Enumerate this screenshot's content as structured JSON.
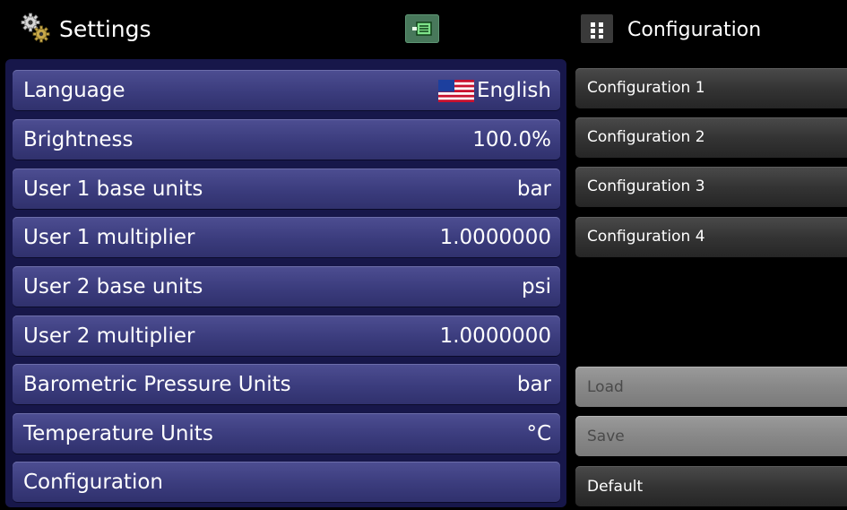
{
  "header": {
    "title": "Settings",
    "title_icon": "gears-icon",
    "io_icon": "io-module-icon",
    "config_title": "Configuration",
    "config_icon": "grid-menu-icon"
  },
  "settings": {
    "rows": [
      {
        "label": "Language",
        "value": "English",
        "icon": "us-flag-icon"
      },
      {
        "label": "Brightness",
        "value": "100.0%"
      },
      {
        "label": "User 1 base units",
        "value": "bar"
      },
      {
        "label": "User 1 multiplier",
        "value": "1.0000000"
      },
      {
        "label": "User 2 base units",
        "value": "psi"
      },
      {
        "label": "User 2 multiplier",
        "value": "1.0000000"
      },
      {
        "label": "Barometric Pressure Units",
        "value": "bar"
      },
      {
        "label": "Temperature Units",
        "value": "°C"
      },
      {
        "label": "Configuration",
        "value": ""
      }
    ]
  },
  "configuration": {
    "items": [
      "Configuration 1",
      "Configuration 2",
      "Configuration 3",
      "Configuration 4"
    ],
    "actions": {
      "load": {
        "label": "Load",
        "enabled": false
      },
      "save": {
        "label": "Save",
        "enabled": false
      },
      "default": {
        "label": "Default",
        "enabled": true
      }
    }
  },
  "colors": {
    "panel": "#17174a",
    "row": "#3b3c7d",
    "io_button": "#48785b",
    "config_item": "#343434",
    "disabled_button": "#888888"
  }
}
